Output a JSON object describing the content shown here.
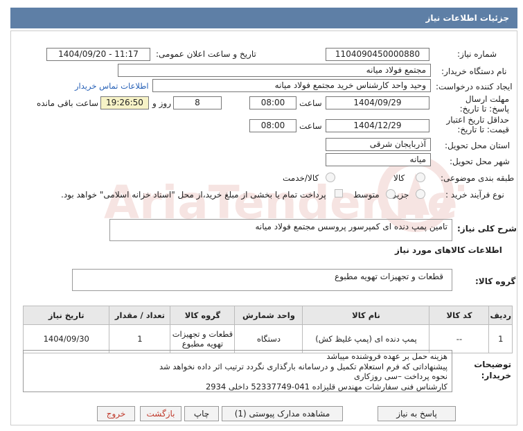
{
  "header": {
    "title": "جزئیات اطلاعات نیاز"
  },
  "form": {
    "need_number_label": "شماره نیاز:",
    "need_number": "1104090450000880",
    "announce_label": "تاریخ و ساعت اعلان عمومی:",
    "announce_value": "1404/09/20 - 11:17",
    "buyer_label": "نام دستگاه خریدار:",
    "buyer_value": "مجتمع فولاد میانه",
    "creator_label": "ایجاد کننده درخواست:",
    "creator_value": "وحید واحد کارشناس خرید مجتمع فولاد میانه",
    "contact_link": "اطلاعات تماس خریدار",
    "deadline_label": "مهلت ارسال پاسخ: تا تاریخ:",
    "deadline_date": "1404/09/29",
    "time_label": "ساعت",
    "deadline_time": "08:00",
    "days_value": "8",
    "days_label": "روز و",
    "remaining_time": "19:26:50",
    "remaining_label": "ساعت باقی مانده",
    "validity_label": "حداقل تاریخ اعتبار قیمت: تا تاریخ:",
    "validity_date": "1404/12/29",
    "validity_time": "08:00",
    "province_label": "استان محل تحویل:",
    "province_value": "آذربایجان شرقی",
    "city_label": "شهر محل تحویل:",
    "city_value": "میانه",
    "category_label": "طبقه بندی موضوعی:",
    "category_options": [
      "کالا",
      "کالا/خدمت"
    ],
    "process_label": "نوع فرآیند خرید :",
    "process_options": [
      "جزیی",
      "متوسط"
    ],
    "payment_note": "پرداخت تمام یا بخشی از مبلغ خرید،از محل \"اسناد خزانه اسلامی\" خواهد بود."
  },
  "summary": {
    "label": "شرح کلی نیاز:",
    "value": "تامین پمپ دنده ای کمپرسور پروسس مجتمع فولاد میانه"
  },
  "goods_info": {
    "title": "اطلاعات کالاهای مورد نیاز"
  },
  "goods_group": {
    "label": "گروه کالا:",
    "value": "قطعات و تجهیزات تهویه مطبوع"
  },
  "table": {
    "headers": [
      "ردیف",
      "کد کالا",
      "نام کالا",
      "واحد شمارش",
      "گروه کالا",
      "تعداد / مقدار",
      "تاریخ نیاز"
    ],
    "rows": [
      [
        "1",
        "--",
        "پمپ دنده ای (پمپ غلیظ کش)",
        "دستگاه",
        "قطعات و تجهیزات تهویه مطبوع",
        "1",
        "1404/09/30"
      ]
    ]
  },
  "buyer_notes": {
    "label": "توضیحات خریدار:",
    "lines": [
      "هزینه حمل بر عهده فروشنده میباشد",
      "پیشنهاداتی که فرم استعلام تکمیل و درسامانه بارگذاری نگردد ترتیب اثر داده نخواهد شد",
      "نحوه پرداخت –سی روزکاری",
      "کارشناس فنی سفارشات مهندس قلیزاده   041-52337749  داخلی 2934"
    ]
  },
  "buttons": {
    "reply": "پاسخ به نیاز",
    "attachments": "مشاهده مدارک پیوستی (1)",
    "print": "چاپ",
    "back": "بازگشت",
    "exit": "خروج"
  },
  "watermark": {
    "text": "AriaTender.neT"
  },
  "colors": {
    "header": "#5e7fa6",
    "yellow": "#f7f3c7",
    "link": "#2660b6",
    "exit_btn": "#c0392b"
  }
}
